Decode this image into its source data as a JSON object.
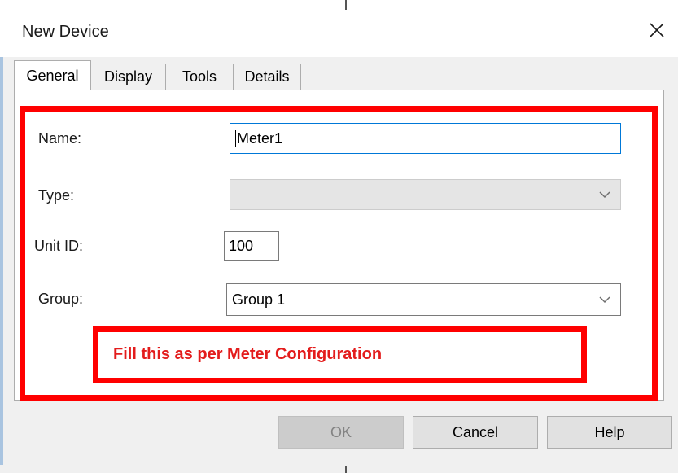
{
  "dialog": {
    "title": "New Device",
    "close_icon": "close-icon"
  },
  "tabs": [
    {
      "label": "General",
      "active": true
    },
    {
      "label": "Display",
      "active": false
    },
    {
      "label": "Tools",
      "active": false
    },
    {
      "label": "Details",
      "active": false
    }
  ],
  "form": {
    "name": {
      "label": "Name:",
      "value": "Meter1"
    },
    "type": {
      "label": "Type:",
      "value": "",
      "disabled": true
    },
    "unit_id": {
      "label": "Unit ID:",
      "value": "100"
    },
    "group": {
      "label": "Group:",
      "value": "Group 1"
    }
  },
  "annotation": {
    "text": "Fill this as per Meter Configuration",
    "color": "#ff0000"
  },
  "buttons": {
    "ok": "OK",
    "cancel": "Cancel",
    "help": "Help"
  },
  "colors": {
    "focus_border": "#0078d7",
    "panel_bg": "#f0f0f0",
    "highlight": "#ff0000"
  }
}
